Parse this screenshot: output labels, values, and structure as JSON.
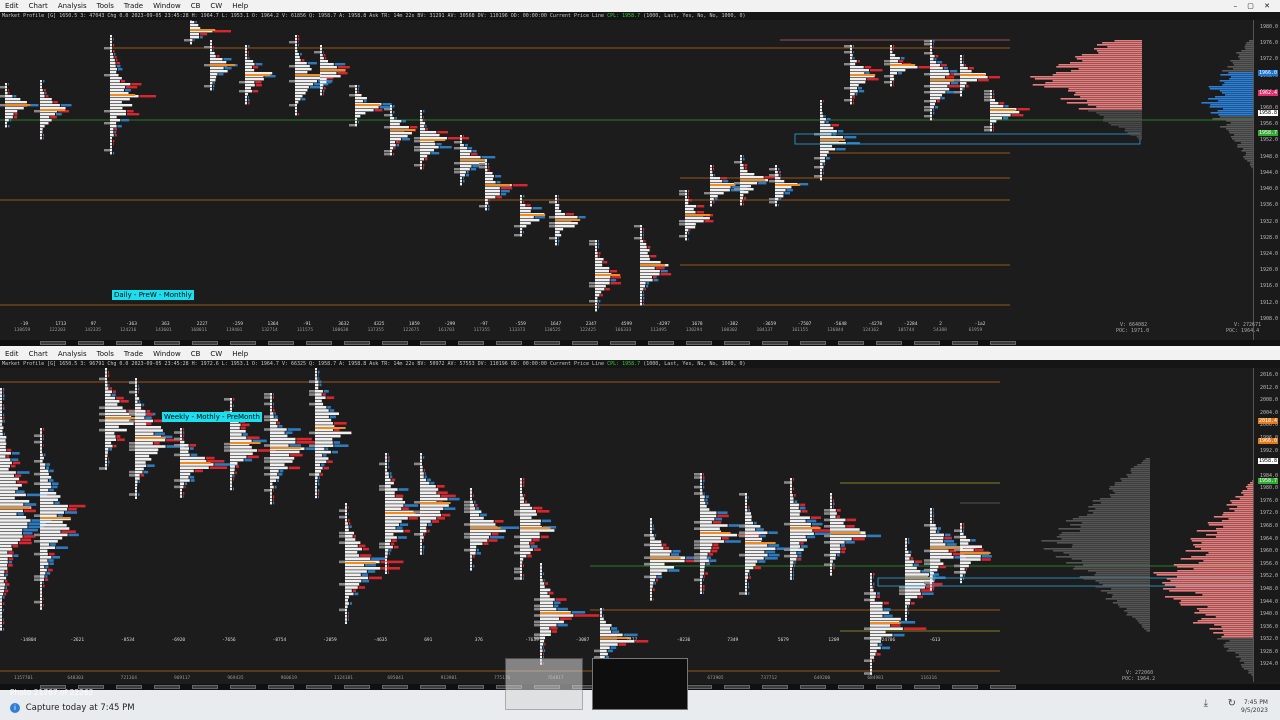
{
  "menu": {
    "items": [
      "Edit",
      "Chart",
      "Analysis",
      "Tools",
      "Trade",
      "Window",
      "CB",
      "CW",
      "Help"
    ]
  },
  "window_title_overlay": "Sierra Chart - Stocks",
  "top": {
    "info": "Market Profile  [G] 1650.5  3: 47043  Chg  0.0    2023-09-05  23:45:28  H: 1964.7  L: 1953.1  O: 1964.2  V: 61856  Q: 1958.7  A: 1958.8  Ask TR: 14m 22s  BV: 31291  AV: 30568  DV: 110196  OD: 00:00:00 Current Price Line",
    "info_highlight": "CPL: 1958.7",
    "info_tail": "(1000, Last, Yes, No, No, 1000, 0)",
    "axis_labels": [
      "1980.0",
      "1976.0",
      "1972.0",
      "1968.0",
      "1964.0",
      "1960.0",
      "1956.0",
      "1952.0",
      "1948.0",
      "1944.0",
      "1940.0",
      "1936.0",
      "1932.0",
      "1928.0",
      "1924.0",
      "1920.0",
      "1916.0",
      "1912.0",
      "1908.0"
    ],
    "price_tags": [
      {
        "text": "1966.0",
        "color": "#1e78d2"
      },
      {
        "text": "1962.4",
        "color": "#e0306f"
      },
      {
        "text": "1958.8",
        "color": "#ffffff"
      },
      {
        "text": "1958.7",
        "color": "#33aa33"
      }
    ],
    "note": "Daily - PreW - Monthly",
    "delta_labels": [
      "-19",
      "1713",
      "97",
      "-363",
      "363",
      "2227",
      "-259",
      "1364",
      "-91",
      "3632",
      "4325",
      "1859",
      "-299",
      "-97",
      "-559",
      "1647",
      "2347",
      "4599",
      "-4297",
      "1678",
      "-382",
      "-3659",
      "-7507",
      "-5648",
      "-4278",
      "-2284",
      "2",
      "-1a2"
    ],
    "volume_labels": [
      "138659",
      "122203",
      "142335",
      "124216",
      "143601",
      "168011",
      "119401",
      "132714",
      "111575",
      "108638",
      "137355",
      "122675",
      "161703",
      "117355",
      "113373",
      "130525",
      "122425",
      "166333",
      "113495",
      "130294",
      "108302",
      "104137",
      "161155",
      "136844",
      "124162",
      "105744",
      "54388",
      "61959"
    ],
    "stats": [
      "V: 664082",
      "POC: 1971.0",
      "V: 272671",
      "POC: 1964.4"
    ],
    "poc_tag": "POC",
    "va_tags": [
      "VAH",
      "VAL",
      "YPG VA"
    ]
  },
  "bottom": {
    "info": "Market Profile  [G] 1650.5  3: 96791  Chg  0.0    2023-09-05  23:45:28  H: 1972.6  L: 1953.1  O: 1964.7  V: 66325  Q: 1958.7  A: 1958.8  Ask TR: 14m 22s  BV: 50972  AV: 57553  DV: 110196  OD: 00:00:00 Current Price Line",
    "info_highlight": "CPL: 1958.7",
    "info_tail": "(1000, Last, Yes, No, No, 1000, 0)",
    "axis_labels": [
      "2016.0",
      "2012.0",
      "2008.0",
      "2004.0",
      "2000.0",
      "1996.0",
      "1992.0",
      "1988.0",
      "1984.0",
      "1980.0",
      "1976.0",
      "1972.0",
      "1968.0",
      "1964.0",
      "1960.0",
      "1956.0",
      "1952.0",
      "1948.0",
      "1944.0",
      "1940.0",
      "1936.0",
      "1932.0",
      "1928.0",
      "1924.0"
    ],
    "price_tags": [
      {
        "text": "2018.4",
        "color": "#e07a1a"
      },
      {
        "text": "1966.0",
        "color": "#e07a1a"
      },
      {
        "text": "1958.8",
        "color": "#ffffff"
      },
      {
        "text": "1958.7",
        "color": "#33aa33"
      }
    ],
    "note": "Weekly - Mothly - PreMonth",
    "delta_labels": [
      "-14804",
      "-2621",
      "-8534",
      "-6920",
      "-7656",
      "-8754",
      "-2059",
      "-4635",
      "691",
      "376",
      "-7639",
      "-3087",
      "2477",
      "-8236",
      "7349",
      "5679",
      "1209",
      "-24706",
      "-613"
    ],
    "volume_labels": [
      "1157701",
      "648303",
      "721164",
      "969117",
      "969435",
      "960619",
      "1124181",
      "695041",
      "913901",
      "775176",
      "764817",
      "778243",
      "769760",
      "673905",
      "737712",
      "649200",
      "684981",
      "116316"
    ],
    "stats": [
      "V: 272060",
      "POC: 1964.2"
    ],
    "poc_tag": "POC",
    "va_tags": [
      "VAH",
      "VAL"
    ]
  },
  "taskbar": {
    "photo_label": "Photo 21767 of 22262",
    "capture_label": "Capture   today at 7:45 PM",
    "time": "7:45 PM",
    "date": "9/5/2023"
  }
}
